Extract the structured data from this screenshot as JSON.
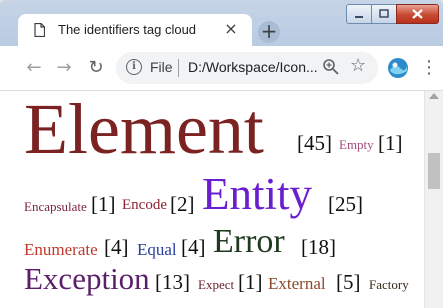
{
  "window": {
    "tab_title": "The identifiers tag cloud",
    "tab_close": "×",
    "new_tab": "+",
    "icons": [
      "document-icon",
      "close-icon",
      "plus-icon",
      "minimize-icon",
      "maximize-icon",
      "close-window-icon"
    ]
  },
  "toolbar": {
    "back": "←",
    "forward": "→",
    "reload": "↻",
    "info": "i",
    "file_label": "File",
    "url": "D:/Workspace/Icon...",
    "star": "☆",
    "menu": "⋮"
  },
  "tags": [
    {
      "name": "Element",
      "count": "[45]",
      "color": "#7b2323"
    },
    {
      "name": "Empty",
      "count": "[1]",
      "color": "#a34a7a"
    },
    {
      "name": "Encapsulate",
      "count": "[1]",
      "color": "#7b2341"
    },
    {
      "name": "Encode",
      "count": "[2]",
      "color": "#8b2332"
    },
    {
      "name": "Entity",
      "count": "[25]",
      "color": "#6a1fcf"
    },
    {
      "name": "Enumerate",
      "count": "[4]",
      "color": "#c0392b"
    },
    {
      "name": "Equal",
      "count": "[4]",
      "color": "#2a3f9a"
    },
    {
      "name": "Error",
      "count": "[18]",
      "color": "#1f3a1f"
    },
    {
      "name": "Exception",
      "count": "[13]",
      "color": "#5a1f6a"
    },
    {
      "name": "Expect",
      "count": "[1]",
      "color": "#6a1f2a"
    },
    {
      "name": "External",
      "count": "[5]",
      "color": "#8b4a2a"
    },
    {
      "name": "Factory",
      "count": "",
      "color": "#3a2a1a"
    }
  ]
}
